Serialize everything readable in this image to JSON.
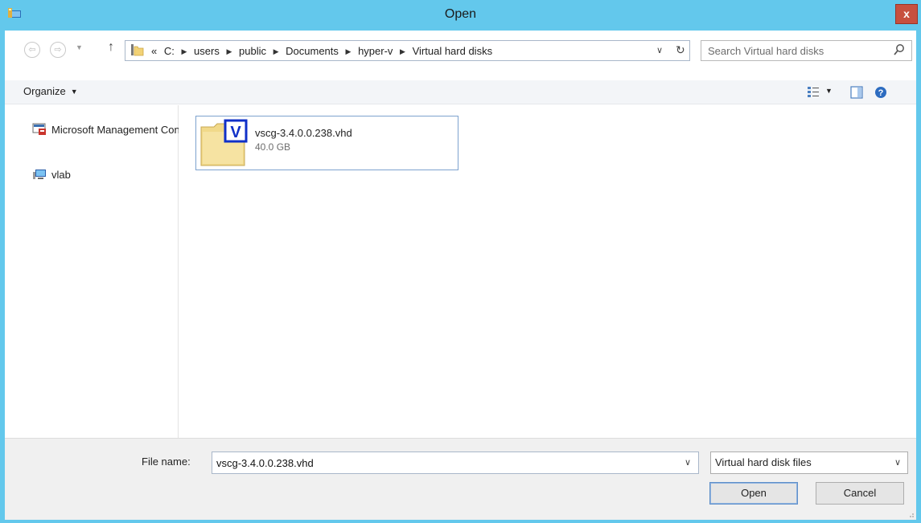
{
  "window": {
    "title": "Open",
    "close_label": "x"
  },
  "address": {
    "overflow": "«",
    "crumbs": [
      "C:",
      "users",
      "public",
      "Documents",
      "hyper-v",
      "Virtual hard disks"
    ]
  },
  "search": {
    "placeholder": "Search Virtual hard disks"
  },
  "toolbar": {
    "organize_label": "Organize"
  },
  "nav_pane": {
    "items": [
      {
        "label": "Microsoft Management Console",
        "icon": "mmc-icon"
      },
      {
        "label": "vlab",
        "icon": "network-computer-icon"
      }
    ]
  },
  "files": [
    {
      "name": "vscg-3.4.0.0.238.vhd",
      "size": "40.0 GB",
      "icon": "vhd-file-icon",
      "selected": true
    }
  ],
  "bottom": {
    "file_name_label": "File name:",
    "file_name_value": "vscg-3.4.0.0.238.vhd",
    "file_type": "Virtual hard disk files",
    "open_label": "Open",
    "cancel_label": "Cancel"
  },
  "colors": {
    "title_bar": "#63c8ec",
    "close_button": "#c7503f",
    "selection_border": "#7da2ce"
  }
}
